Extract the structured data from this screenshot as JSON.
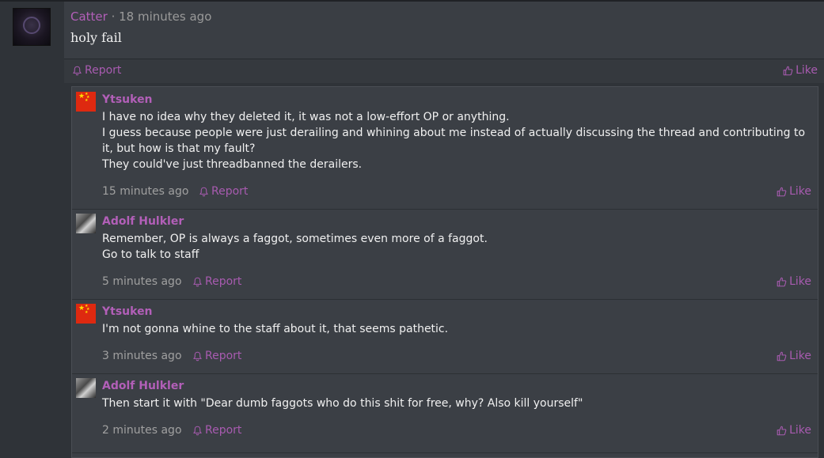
{
  "post": {
    "author": "Catter",
    "separator": " · ",
    "time": "18 minutes ago",
    "body": "holy fail",
    "report_label": "Report",
    "like_label": "Like"
  },
  "replies": [
    {
      "author": "Ytsuken",
      "avatar": "china-flag",
      "lines": [
        "I have no idea why they deleted it, it was not a low-effort OP or anything.",
        "I guess because people were just derailing and whining about me instead of actually discussing the thread and contributing to it, but how is that my fault?",
        "They could've just threadbanned the derailers."
      ],
      "time": "15 minutes ago",
      "report_label": "Report",
      "like_label": "Like"
    },
    {
      "author": "Adolf Hulkler",
      "avatar": "photo-avatar",
      "lines": [
        "Remember, OP is always a faggot, sometimes even more of a faggot.",
        "Go to talk to staff"
      ],
      "time": "5 minutes ago",
      "report_label": "Report",
      "like_label": "Like"
    },
    {
      "author": "Ytsuken",
      "avatar": "china-flag",
      "lines": [
        "I'm not gonna whine to the staff about it, that seems pathetic."
      ],
      "time": "3 minutes ago",
      "report_label": "Report",
      "like_label": "Like"
    },
    {
      "author": "Adolf Hulkler",
      "avatar": "photo-avatar",
      "lines": [
        "Then start it with \"Dear dumb faggots who do this shit for free, why? Also kill yourself\""
      ],
      "time": "2 minutes ago",
      "report_label": "Report",
      "like_label": "Like"
    }
  ],
  "colors": {
    "accent": "#b25fb8",
    "background": "#2f3338",
    "panel": "#3a3e44"
  }
}
